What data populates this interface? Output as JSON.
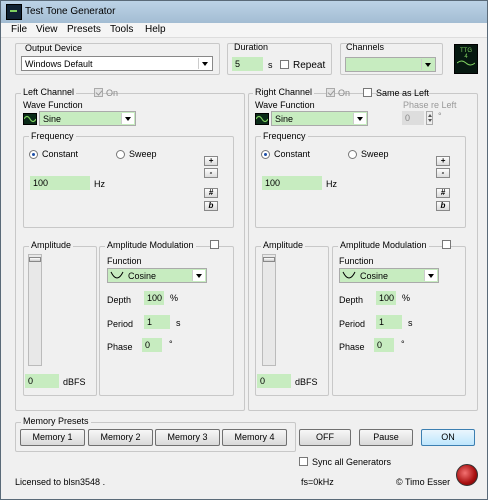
{
  "window": {
    "title": "Test Tone Generator"
  },
  "menu": [
    "File",
    "View",
    "Presets",
    "Tools",
    "Help"
  ],
  "output_device": {
    "label": "Output Device",
    "value": "Windows Default"
  },
  "duration": {
    "label": "Duration",
    "value": "5",
    "unit": "s",
    "repeat_label": "Repeat"
  },
  "channels": {
    "label": "Channels",
    "value": ""
  },
  "logo": {
    "line1": "TTG",
    "line2": "4"
  },
  "left": {
    "title": "Left Channel",
    "on_label": "On",
    "wave_label": "Wave Function",
    "wave_value": "Sine",
    "freq_label": "Frequency",
    "constant": "Constant",
    "sweep": "Sweep",
    "freq_value": "100",
    "freq_unit": "Hz",
    "amp_label": "Amplitude",
    "amp_value": "0",
    "amp_unit": "dBFS",
    "am_label": "Amplitude Modulation",
    "func_label": "Function",
    "func_value": "Cosine",
    "depth_label": "Depth",
    "depth_value": "100",
    "depth_unit": "%",
    "period_label": "Period",
    "period_value": "1",
    "period_unit": "s",
    "phase_label": "Phase",
    "phase_value": "0",
    "phase_unit": "°"
  },
  "right": {
    "title": "Right Channel",
    "on_label": "On",
    "same_as_left": "Same as Left",
    "phase_re_left_label": "Phase re Left",
    "phase_re_left_value": "0",
    "phase_re_left_unit": "°",
    "wave_label": "Wave Function",
    "wave_value": "Sine",
    "freq_label": "Frequency",
    "constant": "Constant",
    "sweep": "Sweep",
    "freq_value": "100",
    "freq_unit": "Hz",
    "amp_label": "Amplitude",
    "amp_value": "0",
    "amp_unit": "dBFS",
    "am_label": "Amplitude Modulation",
    "func_label": "Function",
    "func_value": "Cosine",
    "depth_label": "Depth",
    "depth_value": "100",
    "depth_unit": "%",
    "period_label": "Period",
    "period_value": "1",
    "period_unit": "s",
    "phase_label": "Phase",
    "phase_value": "0",
    "phase_unit": "°"
  },
  "freq_buttons": {
    "plus": "+",
    "minus": "-",
    "sharp": "#",
    "flat": "b"
  },
  "memory": {
    "label": "Memory Presets",
    "m1": "Memory 1",
    "m2": "Memory 2",
    "m3": "Memory 3",
    "m4": "Memory 4"
  },
  "transport": {
    "off": "OFF",
    "pause": "Pause",
    "on": "ON"
  },
  "sync_label": "Sync all Generators",
  "status": {
    "license": "Licensed to blsn3548 .",
    "freq": "fs=0kHz",
    "author": "© Timo Esser"
  },
  "colors": {
    "field_green": "#c7ecc0",
    "accent": "#3c7fb1"
  }
}
